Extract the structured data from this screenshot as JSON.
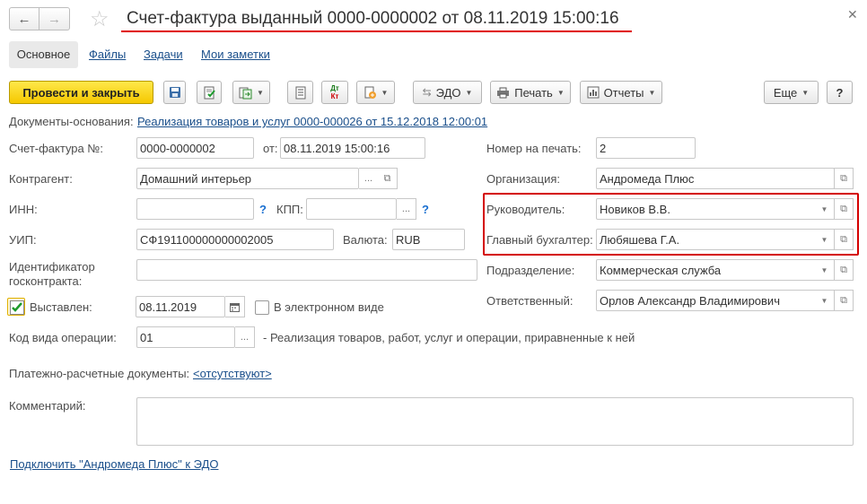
{
  "window": {
    "title": "Счет-фактура выданный 0000-0000002 от 08.11.2019 15:00:16",
    "back_glyph": "←",
    "forward_glyph": "→",
    "star_glyph": "☆",
    "close_glyph": "✕"
  },
  "tabs": [
    {
      "label": "Основное"
    },
    {
      "label": "Файлы"
    },
    {
      "label": "Задачи"
    },
    {
      "label": "Мои заметки"
    }
  ],
  "toolbar": {
    "post_close": "Провести и закрыть",
    "edo": "ЭДО",
    "print": "Печать",
    "reports": "Отчеты",
    "more": "Еще",
    "help": "?",
    "dt_kt_top": "Дт",
    "dt_kt_bottom": "Кт"
  },
  "form": {
    "basis_label": "Документы-основания:",
    "basis_link": "Реализация товаров и услуг 0000-000026 от 15.12.2018 12:00:01",
    "invoice_no_label": "Счет-фактура №:",
    "invoice_no": "0000-0000002",
    "from_label": "от:",
    "date": "08.11.2019 15:00:16",
    "counterparty_label": "Контрагент:",
    "counterparty": "Домашний интерьер",
    "inn_label": "ИНН:",
    "inn": "",
    "kpp_label": "КПП:",
    "kpp": "",
    "uip_label": "УИП:",
    "uip": "СФ191100000000002005",
    "currency_label": "Валюта:",
    "currency": "RUB",
    "contract_id_label_1": "Идентификатор",
    "contract_id_label_2": "госконтракта:",
    "contract_id": "",
    "issued_label": "Выставлен:",
    "issued_checked": true,
    "issued_date": "08.11.2019",
    "electronic_label": "В электронном виде",
    "electronic_checked": false,
    "op_code_label": "Код вида операции:",
    "op_code": "01",
    "op_code_desc": "- Реализация товаров, работ, услуг и операции, приравненные к ней",
    "payment_docs_label": "Платежно-расчетные документы:",
    "payment_docs_link": "<отсутствуют>",
    "comment_label": "Комментарий:",
    "comment": "",
    "print_no_label": "Номер на печать:",
    "print_no": "2",
    "org_label": "Организация:",
    "org": "Андромеда Плюс",
    "head_label": "Руководитель:",
    "head": "Новиков В.В.",
    "accountant_label": "Главный бухгалтер:",
    "accountant": "Любяшева Г.А.",
    "department_label": "Подразделение:",
    "department": "Коммерческая служба",
    "responsible_label": "Ответственный:",
    "responsible": "Орлов Александр Владимирович",
    "edo_link": "Подключить \"Андромеда Плюс\" к ЭДО"
  },
  "colors": {
    "accent_red": "#d40000",
    "link": "#1a4f8b",
    "primary_button": "#f5c800"
  }
}
